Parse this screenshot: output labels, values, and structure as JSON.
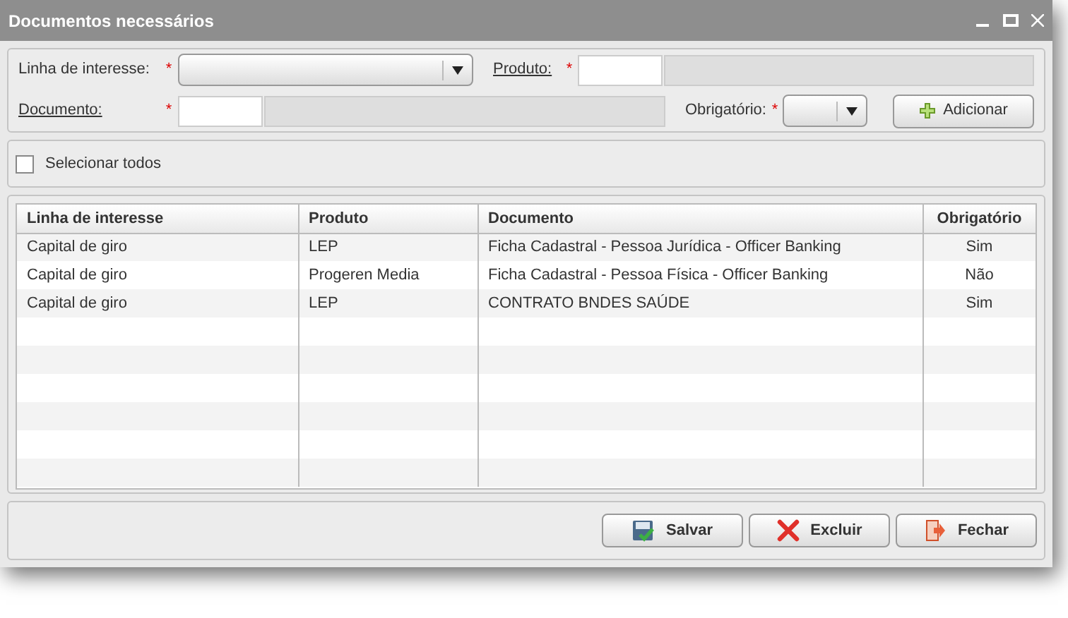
{
  "window": {
    "title": "Documentos necessários"
  },
  "form": {
    "linha_label": "Linha de interesse:",
    "produto_label": "Produto:",
    "documento_label": "Documento:",
    "obrigatorio_label": "Obrigatório:",
    "required_mark": "*",
    "add_button": "Adicionar"
  },
  "select_all": {
    "label": "Selecionar todos",
    "checked": false
  },
  "table": {
    "columns": [
      "Linha de interesse",
      "Produto",
      "Documento",
      "Obrigatório"
    ],
    "rows": [
      [
        "Capital de giro",
        "LEP",
        "Ficha Cadastral - Pessoa Jurídica - Officer Banking",
        "Sim"
      ],
      [
        "Capital de giro",
        "Progeren Media",
        "Ficha Cadastral - Pessoa Física - Officer Banking",
        "Não"
      ],
      [
        "Capital de giro",
        "LEP",
        "CONTRATO BNDES SAÚDE",
        "Sim"
      ]
    ]
  },
  "buttons": [
    {
      "kind": "save",
      "label": "Salvar"
    },
    {
      "kind": "delete",
      "label": "Excluir"
    },
    {
      "kind": "close",
      "label": "Fechar"
    }
  ]
}
